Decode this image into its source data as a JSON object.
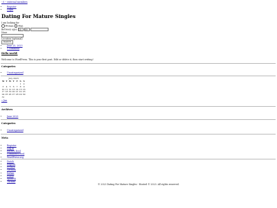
{
  "topbar": {
    "link_text": "- 0 -- external members"
  },
  "nav": {
    "items": [
      "Register",
      "Login"
    ]
  },
  "site": {
    "title": "Dating For Mature Singles"
  },
  "search_form": {
    "label_gender": "I am looking for",
    "option_woman": "Woman",
    "option_man": "Man",
    "label_age": "Between ages",
    "age_from": "18",
    "age_to": "99",
    "label_location": "Near",
    "location_value": "",
    "location_placeholder": "",
    "location_hint": "Location (optional)",
    "submit_label": "Search"
  },
  "post_meta": {
    "date": "June 25, 2023",
    "comments": "1 comment"
  },
  "post": {
    "title": "Hello world!",
    "body": "Welcome to WordPress. This is your first post. Edit or delete it, then start writing!"
  },
  "categories_1": {
    "heading": "Categories",
    "items": [
      "Uncategorized"
    ]
  },
  "calendar": {
    "caption": "July 2023",
    "weekdays": [
      "M",
      "T",
      "W",
      "T",
      "F",
      "S",
      "S"
    ],
    "rows": [
      [
        "",
        "",
        "",
        "",
        "",
        "1",
        "2"
      ],
      [
        "3",
        "4",
        "5",
        "6",
        "7",
        "8",
        "9"
      ],
      [
        "10",
        "11",
        "12",
        "13",
        "14",
        "15",
        "16"
      ],
      [
        "17",
        "18",
        "19",
        "20",
        "21",
        "22",
        "23"
      ],
      [
        "24",
        "25",
        "26",
        "27",
        "28",
        "29",
        "30"
      ],
      [
        "31",
        "",
        "",
        "",
        "",
        "",
        ""
      ]
    ],
    "prev_link": "« Jun"
  },
  "archives": {
    "heading": "Archives",
    "items": [
      "June 2023"
    ]
  },
  "categories_2": {
    "heading": "Categories",
    "items": [
      "Uncategorized"
    ]
  },
  "meta": {
    "heading": "Meta",
    "items": [
      "Register",
      "Log in",
      "Entries feed",
      "Comments feed",
      "WordPress.org"
    ]
  },
  "languages": {
    "items": [
      "Dutch",
      "English",
      "French",
      "German",
      "Italian",
      "Polish",
      "Spanish",
      "Turkish"
    ]
  },
  "footer": {
    "text": "© 2023 Dating For Mature Singles - Hosted © 2023. All rights reserved."
  }
}
